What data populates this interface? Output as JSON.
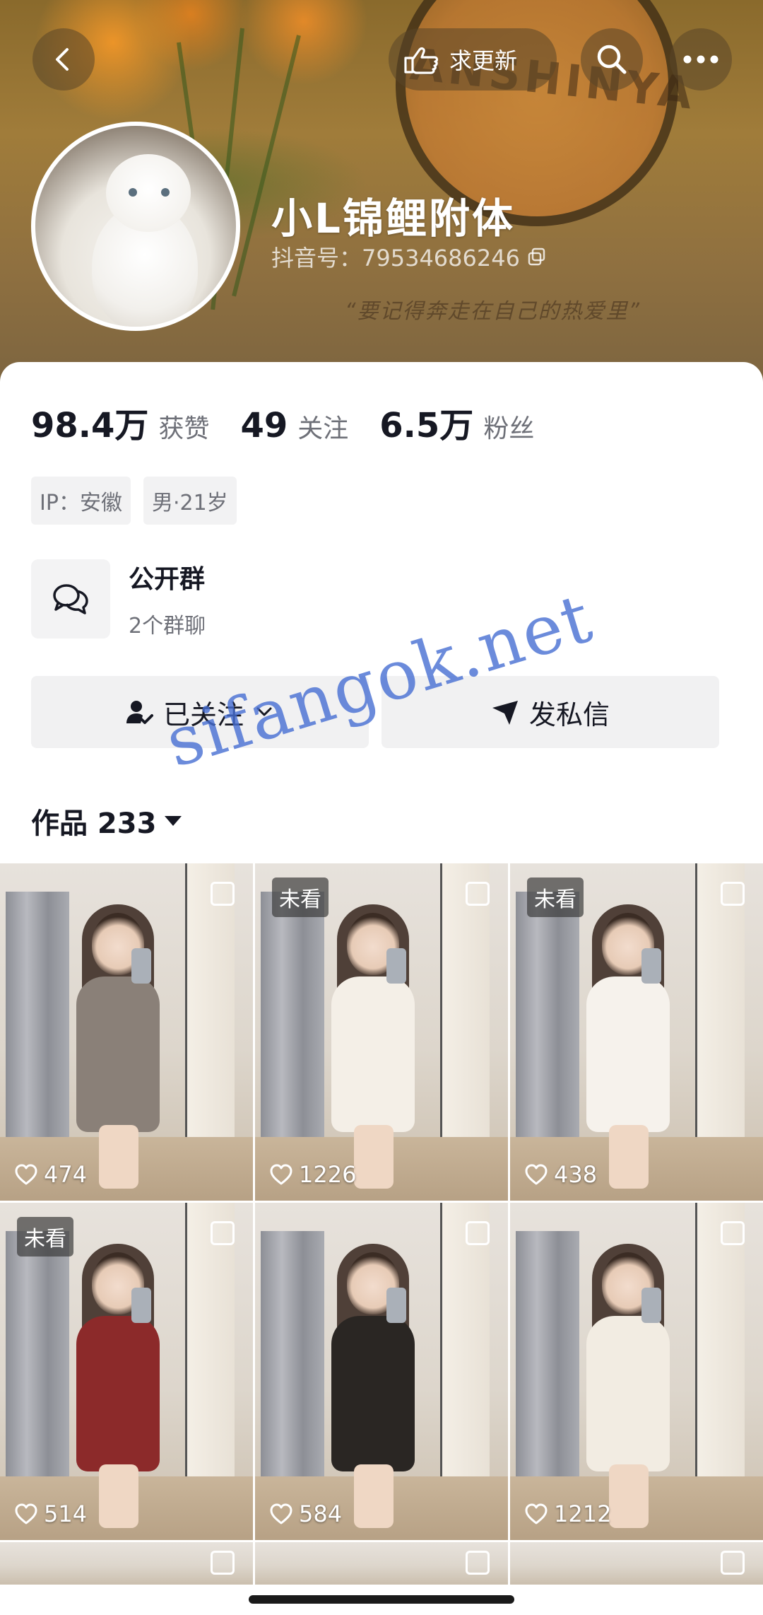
{
  "header": {
    "request_update_label": "求更新",
    "banner_brand_text": "ANSHINYA",
    "banner_quote": "“要记得奔走在自己的热爱里”"
  },
  "profile": {
    "name": "小L锦鲤附体",
    "douyin_id": "抖音号：79534686246"
  },
  "stats": [
    {
      "value": "98.4万",
      "label": "获赞"
    },
    {
      "value": "49",
      "label": "关注"
    },
    {
      "value": "6.5万",
      "label": "粉丝"
    }
  ],
  "tags": [
    "IP：安徽",
    "男·21岁"
  ],
  "group": {
    "title": "公开群",
    "subtitle": "2个群聊"
  },
  "actions": {
    "follow_label": "已关注",
    "message_label": "发私信"
  },
  "works_tab": {
    "label": "作品 233"
  },
  "videos": [
    {
      "likes": "474",
      "unseen": "",
      "dress_color": "#8a8078"
    },
    {
      "likes": "1226",
      "unseen": "未看",
      "dress_color": "#f4efe7"
    },
    {
      "likes": "438",
      "unseen": "未看",
      "dress_color": "#f6f2ec"
    },
    {
      "likes": "514",
      "unseen": "未看",
      "dress_color": "#8c2a2a"
    },
    {
      "likes": "584",
      "unseen": "",
      "dress_color": "#2a2623"
    },
    {
      "likes": "1212",
      "unseen": "",
      "dress_color": "#f2ece2"
    }
  ],
  "watermark": "sifangok.net",
  "colors": {
    "accent_text": "#161823",
    "secondary_text": "#6e7078",
    "button_bg": "#f1f1f2"
  }
}
